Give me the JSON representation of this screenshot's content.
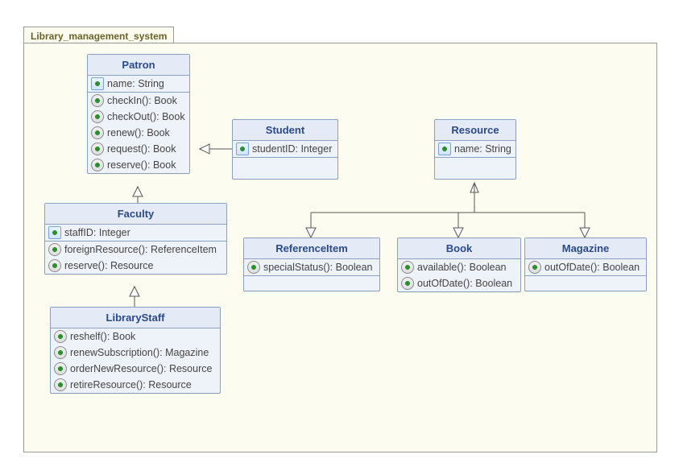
{
  "package": {
    "name": "Library_management_system"
  },
  "classes": {
    "patron": {
      "name": "Patron",
      "attrs": [
        {
          "text": "name: String"
        }
      ],
      "ops": [
        {
          "text": "checkIn(): Book"
        },
        {
          "text": "checkOut(): Book"
        },
        {
          "text": "renew(): Book"
        },
        {
          "text": "request(): Book"
        },
        {
          "text": "reserve(): Book"
        }
      ]
    },
    "student": {
      "name": "Student",
      "attrs": [
        {
          "text": "studentID: Integer"
        }
      ],
      "ops": []
    },
    "resource": {
      "name": "Resource",
      "attrs": [
        {
          "text": "name: String"
        }
      ],
      "ops": []
    },
    "faculty": {
      "name": "Faculty",
      "attrs": [
        {
          "text": "staffID: Integer"
        }
      ],
      "ops": [
        {
          "text": "foreignResource(): ReferenceItem"
        },
        {
          "text": "reserve(): Resource"
        }
      ]
    },
    "referenceItem": {
      "name": "ReferenceItem",
      "attrs": [],
      "ops": [
        {
          "text": "specialStatus(): Boolean"
        }
      ]
    },
    "book": {
      "name": "Book",
      "attrs": [],
      "ops": [
        {
          "text": "available(): Boolean"
        },
        {
          "text": "outOfDate(): Boolean"
        }
      ]
    },
    "magazine": {
      "name": "Magazine",
      "attrs": [],
      "ops": [
        {
          "text": "outOfDate(): Boolean"
        }
      ]
    },
    "libraryStaff": {
      "name": "LibraryStaff",
      "attrs": [],
      "ops": [
        {
          "text": "reshelf(): Book"
        },
        {
          "text": "renewSubscription(): Magazine"
        },
        {
          "text": "orderNewResource(): Resource"
        },
        {
          "text": "retireResource(): Resource"
        }
      ]
    }
  },
  "relationships": [
    {
      "from": "Student",
      "to": "Patron",
      "type": "generalization"
    },
    {
      "from": "Faculty",
      "to": "Patron",
      "type": "generalization"
    },
    {
      "from": "LibraryStaff",
      "to": "Faculty",
      "type": "generalization"
    },
    {
      "from": "ReferenceItem",
      "to": "Resource",
      "type": "generalization"
    },
    {
      "from": "Book",
      "to": "Resource",
      "type": "generalization"
    },
    {
      "from": "Magazine",
      "to": "Resource",
      "type": "generalization"
    }
  ]
}
